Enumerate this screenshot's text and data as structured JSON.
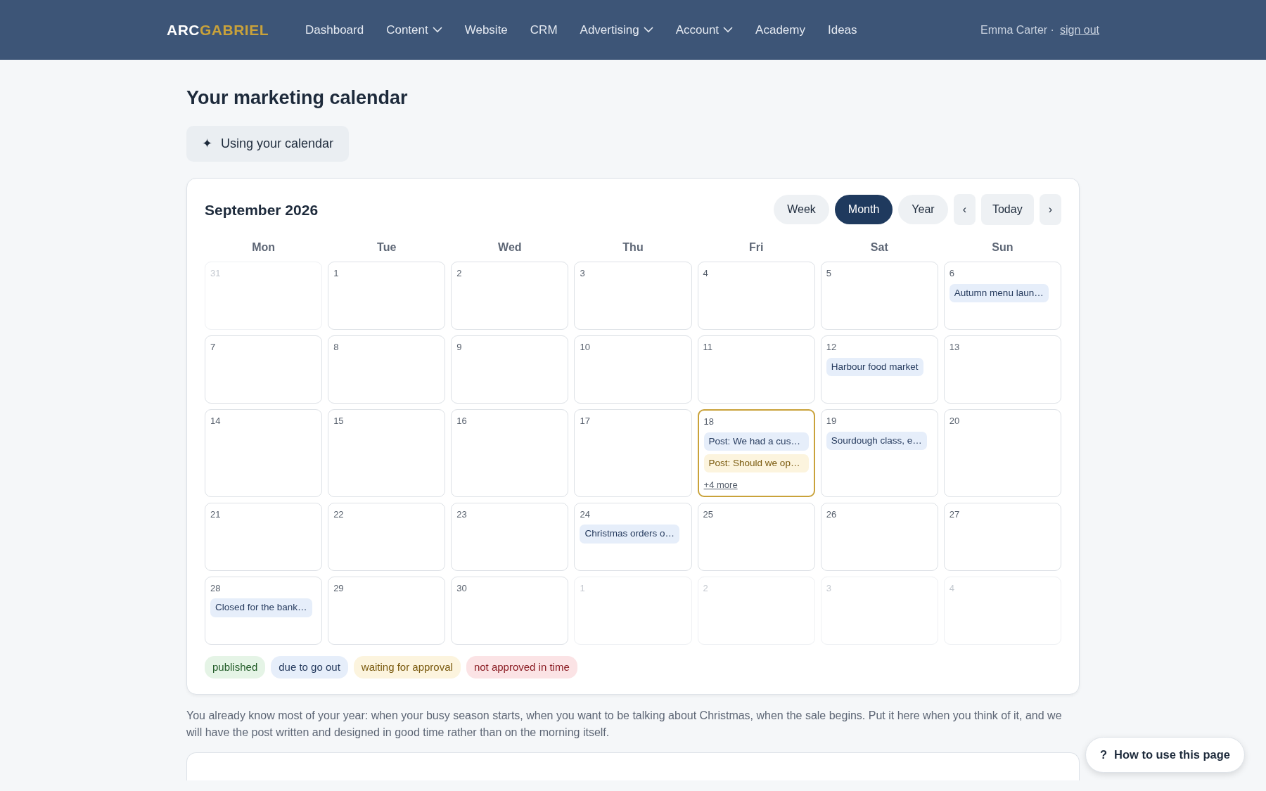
{
  "navbar": {
    "brand": [
      {
        "text": "ARC",
        "kind": "plain"
      },
      {
        "text": "GABRIEL",
        "kind": "accent"
      }
    ],
    "links": [
      {
        "label": "Dashboard"
      },
      {
        "label": "Content",
        "dropdown": true
      },
      {
        "label": "Website"
      },
      {
        "label": "CRM"
      },
      {
        "label": "Advertising",
        "dropdown": true
      },
      {
        "label": "Account",
        "dropdown": true
      },
      {
        "label": "Academy"
      },
      {
        "label": "Ideas"
      }
    ],
    "user": "Emma Carter ·",
    "sign_out": "sign out"
  },
  "title": "Your marketing calendar",
  "help_button": {
    "icon": "✦",
    "label": "Using your calendar"
  },
  "calendar": {
    "title": "September 2026",
    "views": [
      {
        "label": "Week",
        "selected": false
      },
      {
        "label": "Month",
        "selected": true
      },
      {
        "label": "Year",
        "selected": false
      }
    ],
    "prev": "‹",
    "today": "Today",
    "next": "›",
    "weekdays": [
      "Mon",
      "Tue",
      "Wed",
      "Thu",
      "Fri",
      "Sat",
      "Sun"
    ],
    "weeks": [
      [
        {
          "day": "31",
          "muted": true
        },
        {
          "day": "1"
        },
        {
          "day": "2"
        },
        {
          "day": "3"
        },
        {
          "day": "4"
        },
        {
          "day": "5"
        },
        {
          "day": "6",
          "events": [
            {
              "text": "Autumn menu laun…",
              "kind": "due"
            }
          ]
        }
      ],
      [
        {
          "day": "7"
        },
        {
          "day": "8"
        },
        {
          "day": "9"
        },
        {
          "day": "10"
        },
        {
          "day": "11"
        },
        {
          "day": "12",
          "events": [
            {
              "text": "Harbour food market",
              "kind": "due"
            }
          ]
        },
        {
          "day": "13"
        }
      ],
      [
        {
          "day": "14"
        },
        {
          "day": "15"
        },
        {
          "day": "16"
        },
        {
          "day": "17"
        },
        {
          "day": "18",
          "today": true,
          "events": [
            {
              "text": "Post: We had a cus…",
              "kind": "due"
            },
            {
              "text": "Post: Should we op…",
              "kind": "waiting"
            }
          ],
          "more": "+4 more"
        },
        {
          "day": "19",
          "events": [
            {
              "text": "Sourdough class, e…",
              "kind": "due"
            }
          ]
        },
        {
          "day": "20"
        }
      ],
      [
        {
          "day": "21"
        },
        {
          "day": "22"
        },
        {
          "day": "23"
        },
        {
          "day": "24",
          "events": [
            {
              "text": "Christmas orders o…",
              "kind": "due"
            }
          ]
        },
        {
          "day": "25"
        },
        {
          "day": "26"
        },
        {
          "day": "27"
        }
      ],
      [
        {
          "day": "28",
          "events": [
            {
              "text": "Closed for the bank…",
              "kind": "due"
            }
          ]
        },
        {
          "day": "29"
        },
        {
          "day": "30"
        },
        {
          "day": "1",
          "muted": true
        },
        {
          "day": "2",
          "muted": true
        },
        {
          "day": "3",
          "muted": true
        },
        {
          "day": "4",
          "muted": true
        }
      ]
    ],
    "legend": [
      {
        "text": "published",
        "kind": "published"
      },
      {
        "text": "due to go out",
        "kind": "due"
      },
      {
        "text": "waiting for approval",
        "kind": "waiting"
      },
      {
        "text": "not approved in time",
        "kind": "late"
      }
    ]
  },
  "intro": "You already know most of your year: when your busy season starts, when you want to be talking about Christmas, when the sale begins. Put it here when you think of it, and we will have the post written and designed in good time rather than on the morning itself.",
  "floating_help": {
    "icon": "?",
    "label": "How to use this page"
  }
}
